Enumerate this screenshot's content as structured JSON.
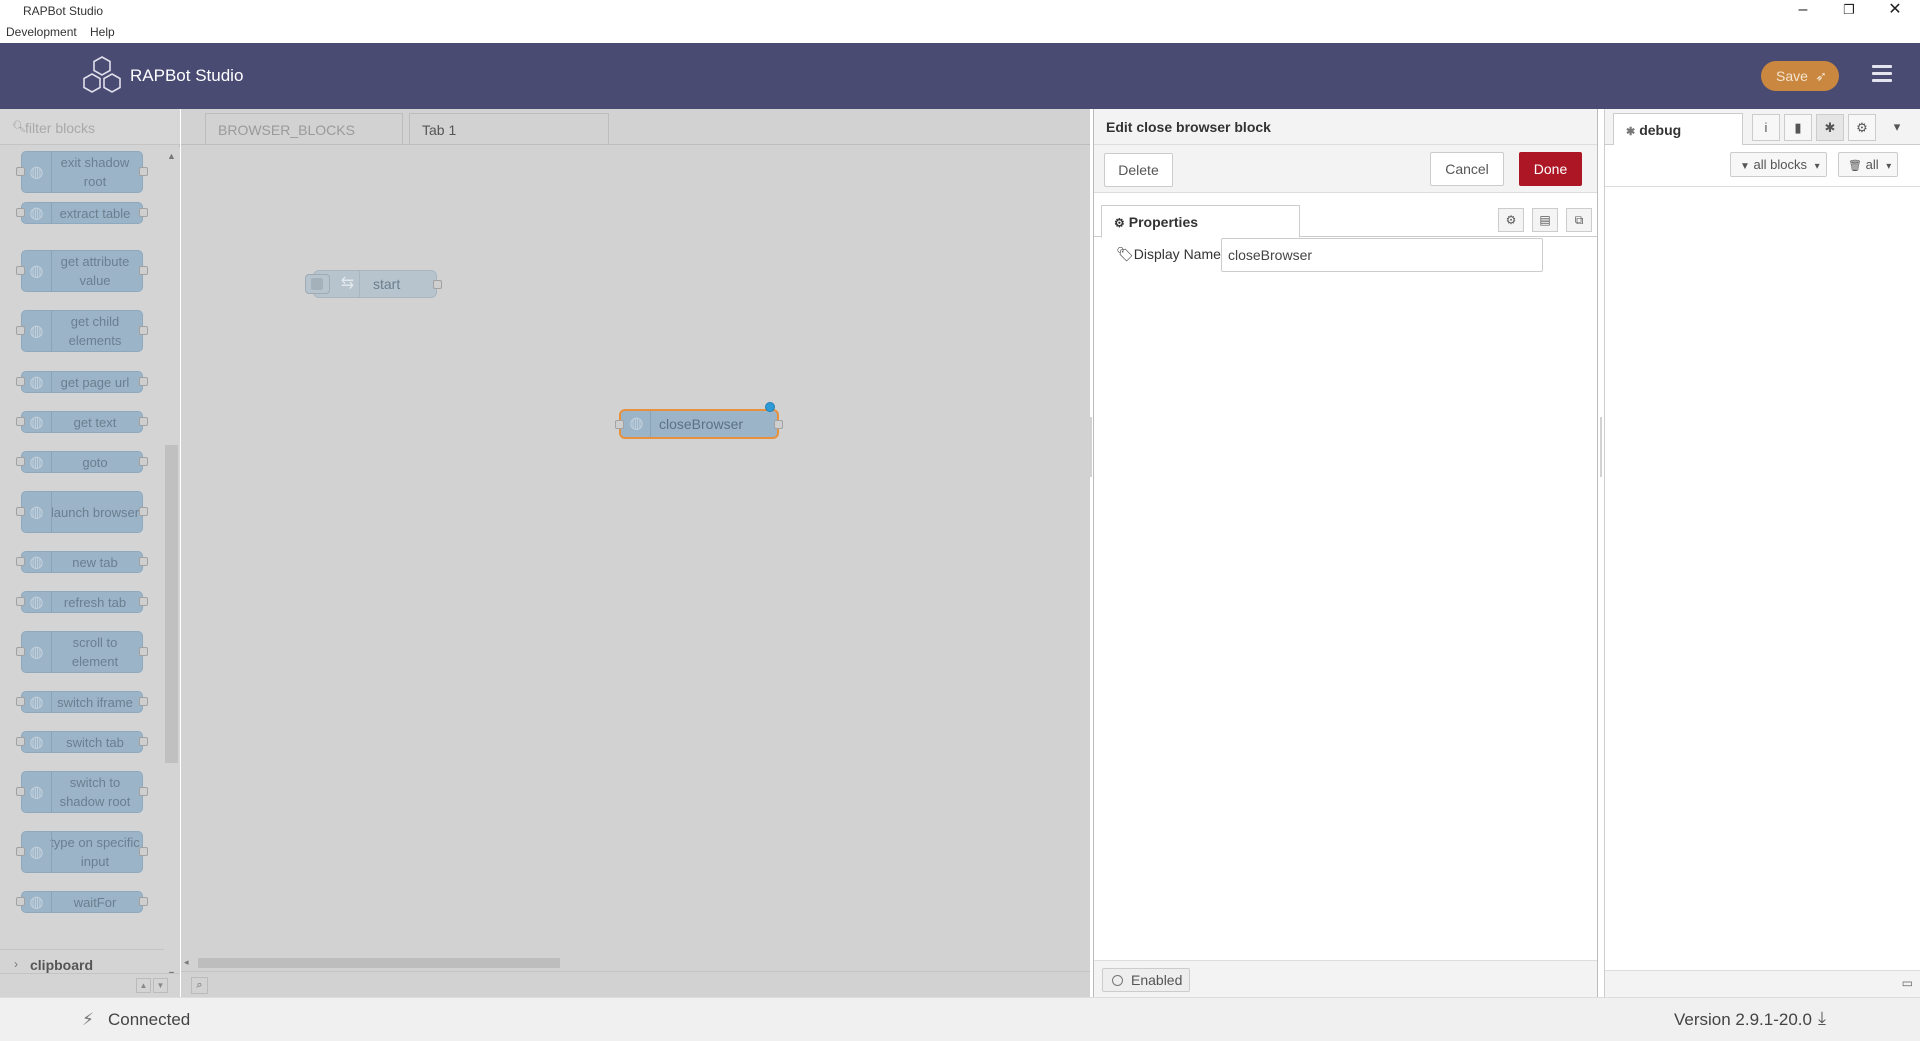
{
  "window": {
    "title": "RAPBot Studio",
    "menu": [
      "Development",
      "Help"
    ],
    "controls": {
      "minimize": "–",
      "maximize": "❐",
      "close": "✕"
    }
  },
  "header": {
    "brand": "RAPBot Studio",
    "save_label": "Save",
    "icons": {
      "logo": "hexagon-logo-icon",
      "save": "rocket-icon",
      "menu": "hamburger-icon"
    },
    "colors": {
      "header_bg": "#4a4b73",
      "save_bg": "#c9873f"
    }
  },
  "palette": {
    "filter_placeholder": "filter blocks",
    "blocks": [
      "exit shadow root",
      "extract table",
      "get attribute value",
      "get child elements",
      "get page url",
      "get text",
      "goto",
      "launch browser",
      "new tab",
      "refresh tab",
      "scroll to element",
      "switch iframe",
      "switch tab",
      "switch to shadow root",
      "type on specific input",
      "waitFor"
    ],
    "category": "clipboard",
    "block_color": "#9bb4c8"
  },
  "workspace": {
    "tabs": [
      "BROWSER_BLOCKS",
      "Tab 1"
    ],
    "active_tab": "Tab 1",
    "nodes": {
      "start": "start",
      "close": "closeBrowser"
    }
  },
  "tray": {
    "title": "Edit close browser block",
    "delete_label": "Delete",
    "cancel_label": "Cancel",
    "done_label": "Done",
    "properties_tab": "Properties",
    "field_label": "Display Name",
    "field_value": "closeBrowser",
    "enabled_label": "Enabled",
    "done_color": "#ad1625"
  },
  "sidebar": {
    "tab": "debug",
    "filter_label": "all blocks",
    "clear_label": "all",
    "icons": [
      "info-icon",
      "book-icon",
      "bug-icon",
      "gear-icon",
      "chevron-down-icon"
    ]
  },
  "status": {
    "connection": "Connected",
    "version": "Version 2.9.1-20.0"
  }
}
